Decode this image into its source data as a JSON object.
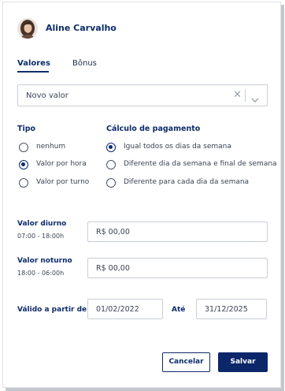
{
  "user": {
    "name": "Aline Carvalho"
  },
  "tabs": [
    {
      "label": "Valores",
      "active": true
    },
    {
      "label": "Bônus",
      "active": false
    }
  ],
  "value_select": {
    "value": "Novo valor"
  },
  "tipo": {
    "title": "Tipo",
    "options": [
      {
        "label": "nenhum",
        "checked": false
      },
      {
        "label": "Valor por hora",
        "checked": true
      },
      {
        "label": "Valor por turno",
        "checked": false
      }
    ]
  },
  "calculo": {
    "title": "Cálculo de pagamento",
    "options": [
      {
        "label": "Igual todos os dias da semana",
        "checked": true
      },
      {
        "label": "Diferente dia da semana e final de semana",
        "checked": false
      },
      {
        "label": "Diferente para cada dia da semana",
        "checked": false
      }
    ]
  },
  "valor_diurno": {
    "label": "Valor diurno",
    "hours": "07:00 - 18:00h",
    "value": "R$ 00,00"
  },
  "valor_noturno": {
    "label": "Valor noturno",
    "hours": "18:00 - 06:00h",
    "value": "R$ 00,00"
  },
  "validade": {
    "label": "Válido a partir de",
    "start": "01/02/2022",
    "until_label": "Até",
    "end": "31/12/2025"
  },
  "actions": {
    "cancel": "Cancelar",
    "save": "Salvar"
  },
  "colors": {
    "primary": "#0d2c6b",
    "button": "#0b2669",
    "border": "#c9ced6"
  },
  "icons": {
    "clear": "close-icon",
    "dropdown": "chevron-down-icon",
    "avatar": "user-avatar"
  }
}
